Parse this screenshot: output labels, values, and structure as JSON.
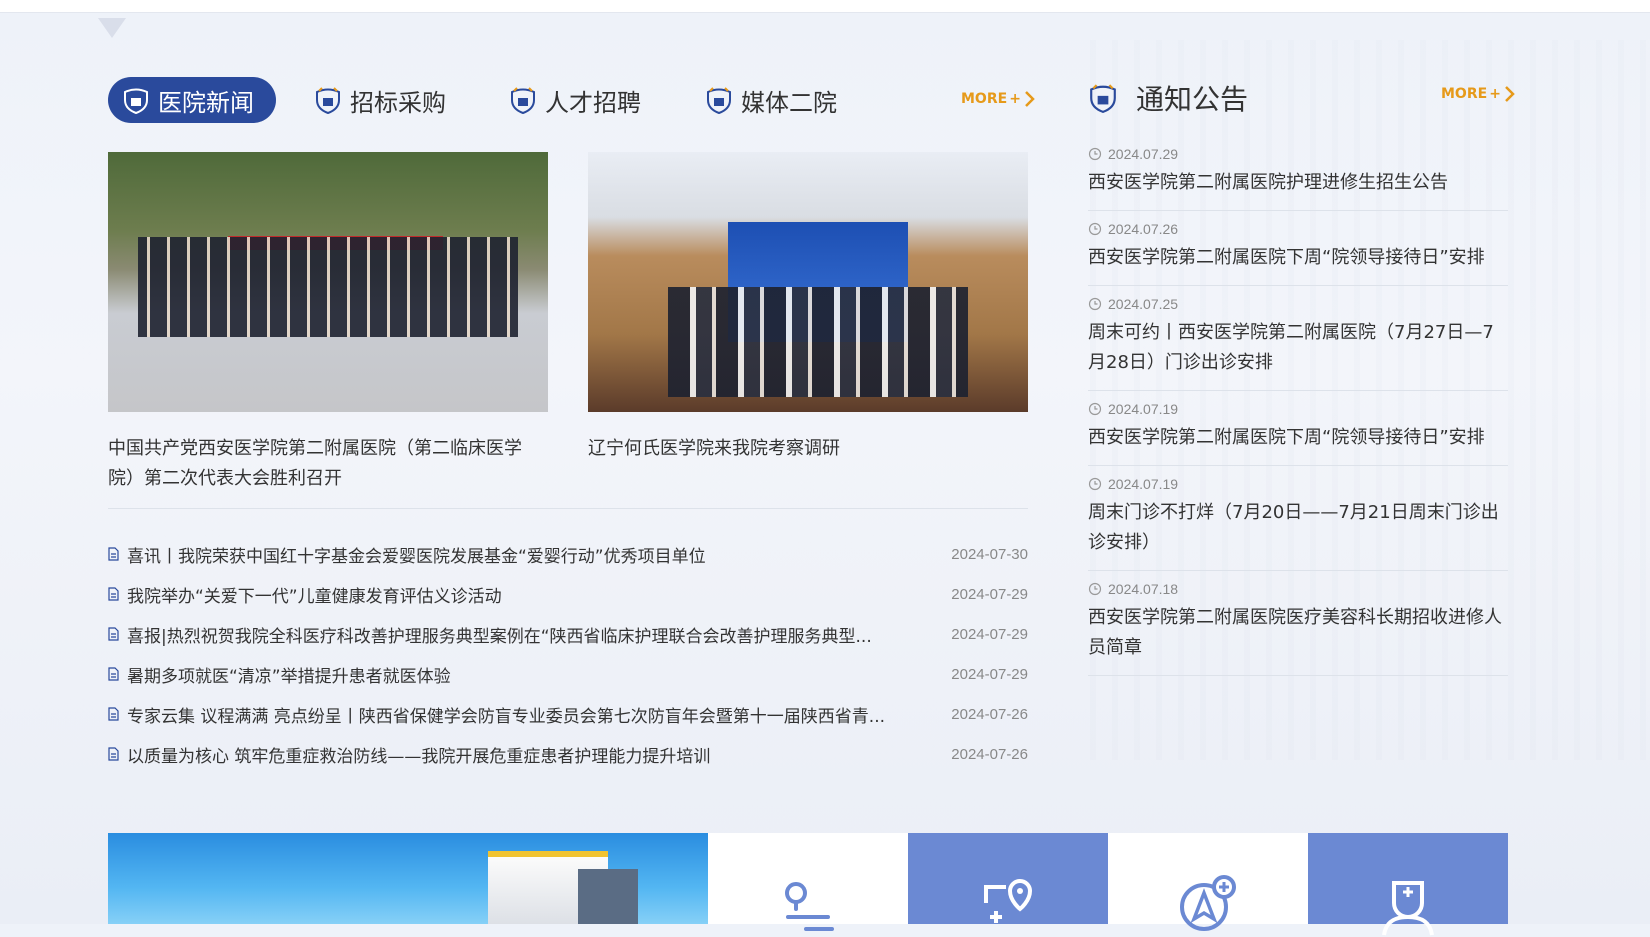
{
  "tabs": [
    {
      "label": "医院新闻",
      "active": true
    },
    {
      "label": "招标采购",
      "active": false
    },
    {
      "label": "人才招聘",
      "active": false
    },
    {
      "label": "媒体二院",
      "active": false
    }
  ],
  "news_more": "MORE",
  "notices_more": "MORE",
  "featured": [
    {
      "caption": "中国共产党西安医学院第二附属医院（第二临床医学院）第二次代表大会胜利召开"
    },
    {
      "caption": "辽宁何氏医学院来我院考察调研"
    }
  ],
  "news": [
    {
      "title": "喜讯丨我院荣获中国红十字基金会爱婴医院发展基金“爱婴行动”优秀项目单位",
      "date": "2024-07-30"
    },
    {
      "title": "我院举办“关爱下一代”儿童健康发育评估义诊活动",
      "date": "2024-07-29"
    },
    {
      "title": "喜报|热烈祝贺我院全科医疗科改善护理服务典型案例在“陕西省临床护理联合会改善护理服务典型...",
      "date": "2024-07-29"
    },
    {
      "title": "暑期多项就医“清凉”举措提升患者就医体验",
      "date": "2024-07-29"
    },
    {
      "title": "专家云集 议程满满 亮点纷呈丨陕西省保健学会防盲专业委员会第七次防盲年会暨第十一届陕西省青...",
      "date": "2024-07-26"
    },
    {
      "title": "以质量为核心 筑牢危重症救治防线——我院开展危重症患者护理能力提升培训",
      "date": "2024-07-26"
    }
  ],
  "notices_title": "通知公告",
  "notices": [
    {
      "date": "2024.07.29",
      "text": "西安医学院第二附属医院护理进修生招生公告"
    },
    {
      "date": "2024.07.26",
      "text": "西安医学院第二附属医院下周“院领导接待日”安排"
    },
    {
      "date": "2024.07.25",
      "text": "周末可约丨西安医学院第二附属医院（7月27日—7月28日）门诊出诊安排"
    },
    {
      "date": "2024.07.19",
      "text": "西安医学院第二附属医院下周“院领导接待日”安排"
    },
    {
      "date": "2024.07.19",
      "text": "周末门诊不打烊（7月20日——7月21日周末门诊出诊安排）"
    },
    {
      "date": "2024.07.18",
      "text": "西安医学院第二附属医院医疗美容科长期招收进修人员简章"
    }
  ],
  "colors": {
    "primary": "#2a4a9c",
    "more": "#e69a1a",
    "tile_blue": "#6b89d3"
  },
  "bottom_icons": [
    "route-pin-icon",
    "medical-location-icon",
    "navigation-plus-icon",
    "doctor-icon"
  ]
}
